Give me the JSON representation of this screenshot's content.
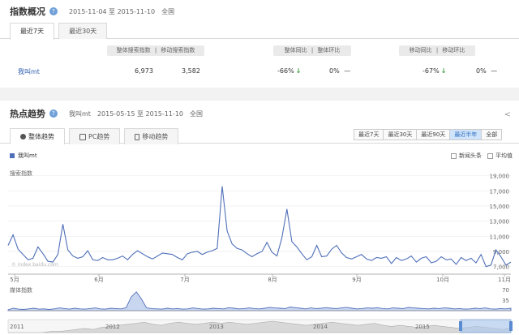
{
  "overview": {
    "title": "指数概况",
    "date_range": "2015-11-04 至 2015-11-10",
    "region": "全国",
    "tabs": [
      "最近7天",
      "最近30天"
    ],
    "headers": {
      "overall_index": "整体搜索指数",
      "sep1": "|",
      "mobile_index": "移动搜索指数",
      "overall_yoy": "整体同比",
      "sep2": "|",
      "overall_mom": "整体环比",
      "mobile_yoy": "移动同比",
      "sep3": "|",
      "mobile_mom": "移动环比"
    },
    "row": {
      "keyword": "我叫mt",
      "overall_index": "6,973",
      "mobile_index": "3,582",
      "overall_yoy": "-66%",
      "overall_mom": "0%",
      "overall_mom_dash": "—",
      "mobile_yoy": "-67%",
      "mobile_mom": "0%",
      "mobile_mom_dash": "—"
    },
    "down_arrow_color": "#3a9b3a"
  },
  "trend": {
    "title": "热点趋势",
    "keyword": "我叫mt",
    "date_range": "2015-05-15 至 2015-11-10",
    "region": "全国",
    "tabs": [
      "整体趋势",
      "PC趋势",
      "移动趋势"
    ],
    "range_buttons": [
      "最近7天",
      "最近30天",
      "最近90天",
      "最近半年",
      "全部"
    ],
    "active_range": "最近半年",
    "legend": "我叫mt",
    "checkbox_news": "新闻头条",
    "checkbox_avg": "平均值",
    "watermark": "© index.baidu.com",
    "line_color": "#4f6fb8"
  },
  "chart_data": [
    {
      "type": "line",
      "ylabel": "搜索指数",
      "y_ticks": [
        "19,000",
        "17,000",
        "15,000",
        "13,000",
        "11,000",
        "9,000",
        "7,000"
      ],
      "ylim": [
        6000,
        19500
      ],
      "x_ticks": [
        "5月",
        "6月",
        "7月",
        "8月",
        "9月",
        "10月",
        "11月"
      ],
      "series": [
        {
          "name": "我叫mt",
          "values": [
            9800,
            11200,
            9300,
            8600,
            7900,
            8100,
            9600,
            8700,
            7700,
            7600,
            8600,
            12600,
            9200,
            8400,
            8100,
            8300,
            9100,
            7900,
            7800,
            8200,
            7900,
            7900,
            8100,
            8400,
            7900,
            8600,
            9100,
            8700,
            8300,
            8000,
            8400,
            8800,
            8700,
            8600,
            8200,
            7900,
            8700,
            8900,
            9000,
            8600,
            8900,
            9100,
            9400,
            17600,
            11700,
            10000,
            9400,
            9200,
            8700,
            8300,
            8700,
            9000,
            10200,
            8900,
            8400,
            10800,
            14600,
            10300,
            9600,
            8700,
            7900,
            8300,
            9800,
            8300,
            8400,
            9300,
            9800,
            8800,
            8200,
            8000,
            8300,
            8600,
            8000,
            7800,
            8200,
            8100,
            8300,
            7400,
            8200,
            7800,
            8000,
            8400,
            7600,
            8100,
            8300,
            7500,
            7700,
            8300,
            7900,
            8000,
            7300,
            8200,
            7800,
            8100,
            7500,
            8600,
            7000,
            7200,
            9200,
            8300,
            7200,
            7600
          ]
        }
      ],
      "grid": true
    },
    {
      "type": "area",
      "ylabel": "媒体指数",
      "y_ticks": [
        "70",
        "35"
      ],
      "ylim": [
        0,
        80
      ],
      "series": [
        {
          "name": "我叫mt",
          "values": [
            3,
            8,
            5,
            4,
            6,
            8,
            5,
            6,
            4,
            6,
            9,
            7,
            5,
            8,
            6,
            5,
            7,
            9,
            6,
            5,
            8,
            7,
            6,
            10,
            45,
            62,
            38,
            9,
            7,
            6,
            5,
            8,
            6,
            7,
            5,
            6,
            9,
            7,
            5,
            6,
            8,
            7,
            6,
            10,
            8,
            6,
            7,
            9,
            7,
            6,
            8,
            11,
            9,
            8,
            7,
            12,
            10,
            8,
            6,
            9,
            7,
            8,
            10,
            8,
            7,
            9,
            11,
            8,
            6,
            7,
            9,
            8,
            10,
            7,
            6,
            9,
            8,
            7,
            11,
            9,
            8,
            7,
            6,
            8,
            7,
            9,
            8,
            6,
            7,
            5,
            6,
            8,
            7,
            9,
            6,
            5,
            7,
            6,
            8
          ]
        }
      ]
    },
    {
      "type": "area",
      "x_ticks": [
        "2011",
        "2012",
        "2013",
        "2014",
        "2015"
      ],
      "series": [
        {
          "values": [
            0,
            0,
            0,
            0,
            0,
            1,
            1,
            2,
            3,
            4,
            3,
            5,
            6,
            7,
            8,
            9,
            10,
            8,
            7,
            9,
            10,
            9,
            8,
            9,
            10,
            9,
            10,
            9,
            8,
            9,
            10,
            11,
            10,
            9,
            8,
            7,
            8,
            9,
            10,
            9,
            8,
            7,
            8,
            9,
            7,
            6,
            7,
            6,
            5,
            6,
            7,
            6,
            5,
            4,
            5,
            6,
            5,
            4,
            3,
            4
          ]
        }
      ]
    }
  ]
}
